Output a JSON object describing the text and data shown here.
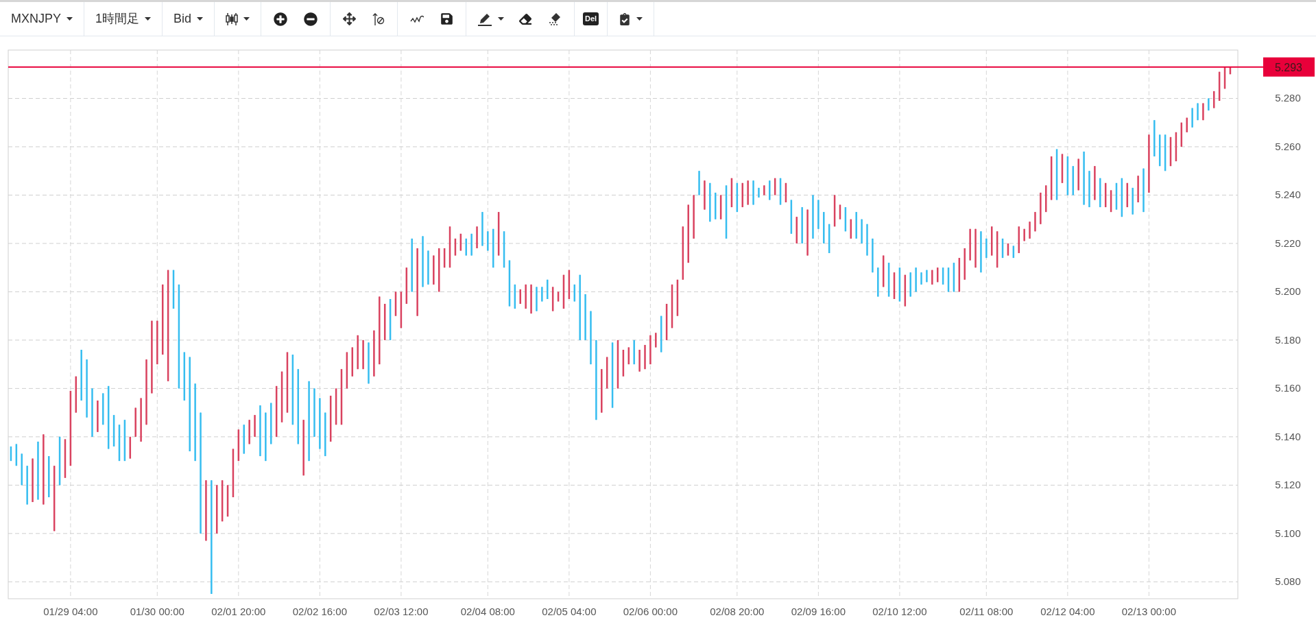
{
  "toolbar": {
    "groups": [
      {
        "items": [
          {
            "kind": "dropdown",
            "label": "MXNJPY"
          }
        ]
      },
      {
        "items": [
          {
            "kind": "dropdown",
            "label": "1時間足"
          }
        ]
      },
      {
        "items": [
          {
            "kind": "dropdown",
            "label": "Bid"
          }
        ]
      },
      {
        "items": [
          {
            "kind": "icon-menu"
          }
        ]
      },
      {
        "items": [
          {
            "kind": "icon"
          },
          {
            "kind": "icon"
          }
        ]
      },
      {
        "items": [
          {
            "kind": "icon"
          },
          {
            "kind": "icon"
          }
        ]
      },
      {
        "items": [
          {
            "kind": "icon"
          },
          {
            "kind": "icon"
          }
        ]
      },
      {
        "items": [
          {
            "kind": "icon-menu"
          },
          {
            "kind": "icon"
          },
          {
            "kind": "icon"
          }
        ]
      },
      {
        "items": [
          {
            "kind": "text-icon",
            "label": "Del"
          }
        ]
      },
      {
        "items": [
          {
            "kind": "icon-menu"
          }
        ]
      }
    ]
  },
  "chart": {
    "chart_data": {
      "type": "candlestick",
      "ylim": [
        5.073,
        5.3
      ],
      "yticks": [
        {
          "value": 5.08,
          "label": "5.080"
        },
        {
          "value": 5.1,
          "label": "5.100"
        },
        {
          "value": 5.12,
          "label": "5.120"
        },
        {
          "value": 5.14,
          "label": "5.140"
        },
        {
          "value": 5.16,
          "label": "5.160"
        },
        {
          "value": 5.18,
          "label": "5.180"
        },
        {
          "value": 5.2,
          "label": "5.200"
        },
        {
          "value": 5.22,
          "label": "5.220"
        },
        {
          "value": 5.24,
          "label": "5.240"
        },
        {
          "value": 5.26,
          "label": "5.260"
        },
        {
          "value": 5.28,
          "label": "5.280"
        }
      ],
      "categories": [
        null,
        null,
        null,
        null,
        null,
        null,
        null,
        null,
        null,
        null,
        null,
        "01/29 04:00",
        null,
        null,
        null,
        null,
        null,
        null,
        null,
        null,
        null,
        null,
        null,
        null,
        null,
        null,
        null,
        "01/30 00:00",
        null,
        null,
        null,
        null,
        null,
        null,
        null,
        null,
        null,
        null,
        null,
        null,
        null,
        null,
        "02/01 20:00",
        null,
        null,
        null,
        null,
        null,
        null,
        null,
        null,
        null,
        null,
        null,
        null,
        null,
        null,
        "02/02 16:00",
        null,
        null,
        null,
        null,
        null,
        null,
        null,
        null,
        null,
        null,
        null,
        null,
        null,
        null,
        "02/03 12:00",
        null,
        null,
        null,
        null,
        null,
        null,
        null,
        null,
        null,
        null,
        null,
        null,
        null,
        null,
        null,
        "02/04 08:00",
        null,
        null,
        null,
        null,
        null,
        null,
        null,
        null,
        null,
        null,
        null,
        null,
        null,
        null,
        "02/05 04:00",
        null,
        null,
        null,
        null,
        null,
        null,
        null,
        null,
        null,
        null,
        null,
        null,
        null,
        null,
        "02/06 00:00",
        null,
        null,
        null,
        null,
        null,
        null,
        null,
        null,
        null,
        null,
        null,
        null,
        null,
        null,
        null,
        "02/08 20:00",
        null,
        null,
        null,
        null,
        null,
        null,
        null,
        null,
        null,
        null,
        null,
        null,
        null,
        null,
        "02/09 16:00",
        null,
        null,
        null,
        null,
        null,
        null,
        null,
        null,
        null,
        null,
        null,
        null,
        null,
        null,
        "02/10 12:00",
        null,
        null,
        null,
        null,
        null,
        null,
        null,
        null,
        null,
        null,
        null,
        null,
        null,
        null,
        null,
        "02/11 08:00",
        null,
        null,
        null,
        null,
        null,
        null,
        null,
        null,
        null,
        null,
        null,
        null,
        null,
        null,
        "02/12 04:00",
        null,
        null,
        null,
        null,
        null,
        null,
        null,
        null,
        null,
        null,
        null,
        null,
        null,
        null,
        "02/13 00:00",
        null,
        null,
        null,
        null,
        null,
        null,
        null,
        null,
        null,
        null,
        null,
        null,
        null,
        null,
        null
      ],
      "grid": true,
      "ref_lines": [
        {
          "axis": "y",
          "value": 5.293,
          "label": "5.293",
          "color": "#e8003a"
        }
      ],
      "series": [
        {
          "ohlc": [
            [
              5.136,
              5.136,
              5.13,
              5.13
            ],
            [
              5.137,
              5.137,
              5.128,
              5.128
            ],
            [
              5.133,
              5.133,
              5.12,
              5.12
            ],
            [
              5.128,
              5.128,
              5.112,
              5.112
            ],
            [
              5.113,
              5.131,
              5.113,
              5.131
            ],
            [
              5.138,
              5.138,
              5.114,
              5.114
            ],
            [
              5.112,
              5.141,
              5.112,
              5.141
            ],
            [
              5.132,
              5.132,
              5.115,
              5.115
            ],
            [
              5.101,
              5.128,
              5.101,
              5.128
            ],
            [
              5.14,
              5.14,
              5.12,
              5.12
            ],
            [
              5.123,
              5.139,
              5.123,
              5.139
            ],
            [
              5.128,
              5.159,
              5.128,
              5.159
            ],
            [
              5.15,
              5.165,
              5.15,
              5.165
            ],
            [
              5.176,
              5.176,
              5.155,
              5.155
            ],
            [
              5.172,
              5.172,
              5.148,
              5.148
            ],
            [
              5.16,
              5.16,
              5.14,
              5.14
            ],
            [
              5.142,
              5.155,
              5.142,
              5.155
            ],
            [
              5.158,
              5.158,
              5.145,
              5.145
            ],
            [
              5.161,
              5.161,
              5.135,
              5.135
            ],
            [
              5.149,
              5.149,
              5.136,
              5.136
            ],
            [
              5.145,
              5.145,
              5.13,
              5.13
            ],
            [
              5.147,
              5.147,
              5.13,
              5.13
            ],
            [
              5.131,
              5.14,
              5.131,
              5.14
            ],
            [
              5.14,
              5.152,
              5.14,
              5.152
            ],
            [
              5.138,
              5.156,
              5.138,
              5.156
            ],
            [
              5.145,
              5.172,
              5.145,
              5.172
            ],
            [
              5.158,
              5.188,
              5.158,
              5.188
            ],
            [
              5.17,
              5.188,
              5.17,
              5.188
            ],
            [
              5.174,
              5.203,
              5.174,
              5.203
            ],
            [
              5.163,
              5.209,
              5.163,
              5.209
            ],
            [
              5.209,
              5.209,
              5.193,
              5.193
            ],
            [
              5.203,
              5.203,
              5.16,
              5.16
            ],
            [
              5.175,
              5.175,
              5.155,
              5.155
            ],
            [
              5.173,
              5.173,
              5.134,
              5.134
            ],
            [
              5.162,
              5.162,
              5.13,
              5.13
            ],
            [
              5.15,
              5.15,
              5.1,
              5.1
            ],
            [
              5.097,
              5.122,
              5.097,
              5.122
            ],
            [
              5.122,
              5.122,
              5.075,
              5.075
            ],
            [
              5.1,
              5.12,
              5.1,
              5.12
            ],
            [
              5.105,
              5.122,
              5.105,
              5.122
            ],
            [
              5.107,
              5.12,
              5.107,
              5.12
            ],
            [
              5.115,
              5.135,
              5.115,
              5.135
            ],
            [
              5.13,
              5.143,
              5.13,
              5.143
            ],
            [
              5.145,
              5.145,
              5.133,
              5.133
            ],
            [
              5.137,
              5.147,
              5.137,
              5.147
            ],
            [
              5.14,
              5.149,
              5.14,
              5.149
            ],
            [
              5.153,
              5.153,
              5.132,
              5.132
            ],
            [
              5.15,
              5.15,
              5.13,
              5.13
            ],
            [
              5.154,
              5.154,
              5.137,
              5.137
            ],
            [
              5.14,
              5.161,
              5.14,
              5.161
            ],
            [
              5.146,
              5.167,
              5.146,
              5.167
            ],
            [
              5.15,
              5.175,
              5.15,
              5.175
            ],
            [
              5.174,
              5.174,
              5.145,
              5.145
            ],
            [
              5.168,
              5.168,
              5.137,
              5.137
            ],
            [
              5.124,
              5.147,
              5.124,
              5.147
            ],
            [
              5.163,
              5.163,
              5.13,
              5.13
            ],
            [
              5.16,
              5.16,
              5.14,
              5.14
            ],
            [
              5.156,
              5.156,
              5.135,
              5.135
            ],
            [
              5.15,
              5.15,
              5.132,
              5.132
            ],
            [
              5.138,
              5.157,
              5.138,
              5.157
            ],
            [
              5.145,
              5.16,
              5.145,
              5.16
            ],
            [
              5.145,
              5.168,
              5.145,
              5.168
            ],
            [
              5.16,
              5.175,
              5.16,
              5.175
            ],
            [
              5.165,
              5.177,
              5.165,
              5.177
            ],
            [
              5.168,
              5.182,
              5.168,
              5.182
            ],
            [
              5.168,
              5.18,
              5.168,
              5.18
            ],
            [
              5.179,
              5.179,
              5.162,
              5.162
            ],
            [
              5.165,
              5.184,
              5.165,
              5.184
            ],
            [
              5.17,
              5.198,
              5.17,
              5.198
            ],
            [
              5.18,
              5.195,
              5.18,
              5.195
            ],
            [
              5.197,
              5.197,
              5.18,
              5.18
            ],
            [
              5.19,
              5.2,
              5.19,
              5.2
            ],
            [
              5.185,
              5.2,
              5.185,
              5.2
            ],
            [
              5.195,
              5.21,
              5.195,
              5.21
            ],
            [
              5.222,
              5.222,
              5.2,
              5.2
            ],
            [
              5.19,
              5.218,
              5.19,
              5.218
            ],
            [
              5.223,
              5.223,
              5.202,
              5.202
            ],
            [
              5.217,
              5.217,
              5.203,
              5.203
            ],
            [
              5.203,
              5.215,
              5.203,
              5.215
            ],
            [
              5.2,
              5.218,
              5.2,
              5.218
            ],
            [
              5.21,
              5.218,
              5.21,
              5.218
            ],
            [
              5.21,
              5.227,
              5.21,
              5.227
            ],
            [
              5.215,
              5.222,
              5.215,
              5.222
            ],
            [
              5.217,
              5.224,
              5.217,
              5.224
            ],
            [
              5.222,
              5.222,
              5.215,
              5.215
            ],
            [
              5.224,
              5.224,
              5.215,
              5.215
            ],
            [
              5.218,
              5.227,
              5.218,
              5.227
            ],
            [
              5.233,
              5.233,
              5.219,
              5.219
            ],
            [
              5.225,
              5.225,
              5.217,
              5.217
            ],
            [
              5.226,
              5.226,
              5.21,
              5.21
            ],
            [
              5.215,
              5.233,
              5.215,
              5.233
            ],
            [
              5.225,
              5.225,
              5.21,
              5.21
            ],
            [
              5.213,
              5.213,
              5.194,
              5.194
            ],
            [
              5.203,
              5.203,
              5.193,
              5.193
            ],
            [
              5.195,
              5.201,
              5.195,
              5.201
            ],
            [
              5.193,
              5.203,
              5.193,
              5.203
            ],
            [
              5.191,
              5.203,
              5.191,
              5.203
            ],
            [
              5.202,
              5.202,
              5.192,
              5.192
            ],
            [
              5.202,
              5.202,
              5.196,
              5.196
            ],
            [
              5.205,
              5.205,
              5.197,
              5.197
            ],
            [
              5.192,
              5.202,
              5.192,
              5.202
            ],
            [
              5.196,
              5.2,
              5.196,
              5.2
            ],
            [
              5.193,
              5.207,
              5.193,
              5.207
            ],
            [
              5.197,
              5.209,
              5.197,
              5.209
            ],
            [
              5.203,
              5.203,
              5.196,
              5.196
            ],
            [
              5.207,
              5.207,
              5.18,
              5.18
            ],
            [
              5.199,
              5.199,
              5.18,
              5.18
            ],
            [
              5.192,
              5.192,
              5.17,
              5.17
            ],
            [
              5.18,
              5.18,
              5.147,
              5.147
            ],
            [
              5.15,
              5.168,
              5.15,
              5.168
            ],
            [
              5.16,
              5.173,
              5.16,
              5.173
            ],
            [
              5.179,
              5.179,
              5.152,
              5.152
            ],
            [
              5.16,
              5.18,
              5.16,
              5.18
            ],
            [
              5.165,
              5.176,
              5.165,
              5.176
            ],
            [
              5.17,
              5.177,
              5.17,
              5.177
            ],
            [
              5.18,
              5.18,
              5.17,
              5.17
            ],
            [
              5.167,
              5.176,
              5.167,
              5.176
            ],
            [
              5.168,
              5.178,
              5.168,
              5.178
            ],
            [
              5.17,
              5.182,
              5.17,
              5.182
            ],
            [
              5.177,
              5.183,
              5.177,
              5.183
            ],
            [
              5.19,
              5.19,
              5.175,
              5.175
            ],
            [
              5.18,
              5.195,
              5.18,
              5.195
            ],
            [
              5.185,
              5.203,
              5.185,
              5.203
            ],
            [
              5.19,
              5.205,
              5.19,
              5.205
            ],
            [
              5.205,
              5.227,
              5.205,
              5.227
            ],
            [
              5.212,
              5.236,
              5.212,
              5.236
            ],
            [
              5.222,
              5.24,
              5.222,
              5.24
            ],
            [
              5.25,
              5.25,
              5.24,
              5.24
            ],
            [
              5.234,
              5.246,
              5.234,
              5.246
            ],
            [
              5.245,
              5.245,
              5.229,
              5.229
            ],
            [
              5.241,
              5.241,
              5.23,
              5.23
            ],
            [
              5.23,
              5.24,
              5.23,
              5.24
            ],
            [
              5.244,
              5.244,
              5.222,
              5.222
            ],
            [
              5.235,
              5.247,
              5.235,
              5.247
            ],
            [
              5.245,
              5.245,
              5.233,
              5.233
            ],
            [
              5.235,
              5.245,
              5.235,
              5.245
            ],
            [
              5.236,
              5.246,
              5.236,
              5.246
            ],
            [
              5.246,
              5.246,
              5.236,
              5.236
            ],
            [
              5.243,
              5.243,
              5.239,
              5.239
            ],
            [
              5.24,
              5.244,
              5.24,
              5.244
            ],
            [
              5.246,
              5.246,
              5.238,
              5.238
            ],
            [
              5.24,
              5.247,
              5.24,
              5.247
            ],
            [
              5.247,
              5.247,
              5.236,
              5.236
            ],
            [
              5.237,
              5.245,
              5.237,
              5.245
            ],
            [
              5.238,
              5.238,
              5.224,
              5.224
            ],
            [
              5.22,
              5.231,
              5.22,
              5.231
            ],
            [
              5.235,
              5.235,
              5.22,
              5.22
            ],
            [
              5.215,
              5.234,
              5.215,
              5.234
            ],
            [
              5.24,
              5.24,
              5.222,
              5.222
            ],
            [
              5.238,
              5.238,
              5.226,
              5.226
            ],
            [
              5.233,
              5.233,
              5.22,
              5.22
            ],
            [
              5.228,
              5.228,
              5.216,
              5.216
            ],
            [
              5.227,
              5.24,
              5.227,
              5.24
            ],
            [
              5.23,
              5.236,
              5.23,
              5.236
            ],
            [
              5.235,
              5.235,
              5.225,
              5.225
            ],
            [
              5.222,
              5.23,
              5.222,
              5.23
            ],
            [
              5.233,
              5.233,
              5.222,
              5.222
            ],
            [
              5.23,
              5.23,
              5.22,
              5.22
            ],
            [
              5.228,
              5.228,
              5.215,
              5.215
            ],
            [
              5.222,
              5.222,
              5.208,
              5.208
            ],
            [
              5.21,
              5.21,
              5.198,
              5.198
            ],
            [
              5.202,
              5.215,
              5.202,
              5.215
            ],
            [
              5.212,
              5.212,
              5.198,
              5.198
            ],
            [
              5.197,
              5.208,
              5.197,
              5.208
            ],
            [
              5.21,
              5.21,
              5.196,
              5.196
            ],
            [
              5.194,
              5.207,
              5.194,
              5.207
            ],
            [
              5.208,
              5.208,
              5.198,
              5.198
            ],
            [
              5.21,
              5.21,
              5.2,
              5.2
            ],
            [
              5.208,
              5.208,
              5.203,
              5.203
            ],
            [
              5.209,
              5.209,
              5.204,
              5.204
            ],
            [
              5.203,
              5.209,
              5.203,
              5.209
            ],
            [
              5.204,
              5.21,
              5.204,
              5.21
            ],
            [
              5.21,
              5.21,
              5.203,
              5.203
            ],
            [
              5.21,
              5.21,
              5.2,
              5.2
            ],
            [
              5.212,
              5.212,
              5.2,
              5.2
            ],
            [
              5.2,
              5.214,
              5.2,
              5.214
            ],
            [
              5.205,
              5.218,
              5.205,
              5.218
            ],
            [
              5.213,
              5.226,
              5.213,
              5.226
            ],
            [
              5.21,
              5.226,
              5.21,
              5.226
            ],
            [
              5.225,
              5.225,
              5.208,
              5.208
            ],
            [
              5.222,
              5.222,
              5.214,
              5.214
            ],
            [
              5.215,
              5.227,
              5.215,
              5.227
            ],
            [
              5.21,
              5.225,
              5.21,
              5.225
            ],
            [
              5.222,
              5.222,
              5.214,
              5.214
            ],
            [
              5.215,
              5.22,
              5.215,
              5.22
            ],
            [
              5.219,
              5.219,
              5.214,
              5.214
            ],
            [
              5.216,
              5.227,
              5.216,
              5.227
            ],
            [
              5.221,
              5.226,
              5.221,
              5.226
            ],
            [
              5.222,
              5.229,
              5.222,
              5.229
            ],
            [
              5.225,
              5.233,
              5.225,
              5.233
            ],
            [
              5.228,
              5.241,
              5.228,
              5.241
            ],
            [
              5.233,
              5.244,
              5.233,
              5.244
            ],
            [
              5.238,
              5.256,
              5.238,
              5.256
            ],
            [
              5.259,
              5.259,
              5.238,
              5.238
            ],
            [
              5.245,
              5.257,
              5.245,
              5.257
            ],
            [
              5.256,
              5.256,
              5.24,
              5.24
            ],
            [
              5.252,
              5.252,
              5.24,
              5.24
            ],
            [
              5.242,
              5.255,
              5.242,
              5.255
            ],
            [
              5.258,
              5.258,
              5.236,
              5.236
            ],
            [
              5.25,
              5.25,
              5.235,
              5.235
            ],
            [
              5.238,
              5.252,
              5.238,
              5.252
            ],
            [
              5.247,
              5.247,
              5.235,
              5.235
            ],
            [
              5.235,
              5.245,
              5.235,
              5.245
            ],
            [
              5.233,
              5.242,
              5.233,
              5.242
            ],
            [
              5.245,
              5.245,
              5.234,
              5.234
            ],
            [
              5.247,
              5.247,
              5.231,
              5.231
            ],
            [
              5.235,
              5.245,
              5.235,
              5.245
            ],
            [
              5.243,
              5.243,
              5.232,
              5.232
            ],
            [
              5.237,
              5.248,
              5.237,
              5.248
            ],
            [
              5.251,
              5.251,
              5.233,
              5.233
            ],
            [
              5.241,
              5.265,
              5.241,
              5.265
            ],
            [
              5.271,
              5.271,
              5.256,
              5.256
            ],
            [
              5.265,
              5.265,
              5.252,
              5.252
            ],
            [
              5.265,
              5.265,
              5.25,
              5.25
            ],
            [
              5.252,
              5.264,
              5.252,
              5.264
            ],
            [
              5.254,
              5.266,
              5.254,
              5.266
            ],
            [
              5.26,
              5.27,
              5.26,
              5.27
            ],
            [
              5.266,
              5.272,
              5.266,
              5.272
            ],
            [
              5.276,
              5.276,
              5.268,
              5.268
            ],
            [
              5.278,
              5.278,
              5.271,
              5.271
            ],
            [
              5.271,
              5.278,
              5.271,
              5.278
            ],
            [
              5.28,
              5.28,
              5.275,
              5.275
            ],
            [
              5.276,
              5.283,
              5.276,
              5.283
            ],
            [
              5.279,
              5.291,
              5.279,
              5.291
            ],
            [
              5.284,
              5.293,
              5.284,
              5.293
            ],
            [
              5.29,
              5.293,
              5.29,
              5.293
            ]
          ]
        }
      ]
    }
  }
}
